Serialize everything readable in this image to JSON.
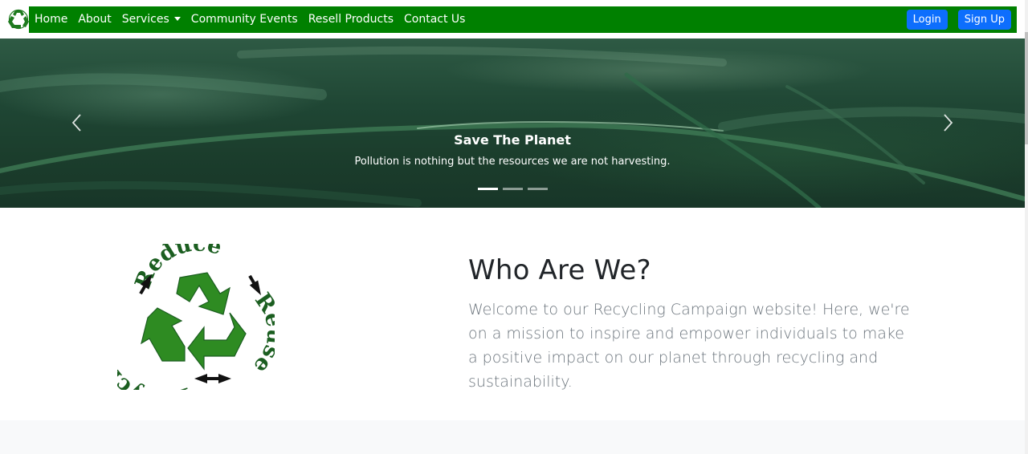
{
  "nav": {
    "logo_icon": "recycle-icon",
    "links": [
      "Home",
      "About",
      "Services",
      "Community Events",
      "Resell Products",
      "Contact Us"
    ],
    "login_label": "Login",
    "signup_label": "Sign Up",
    "bar_color": "#008000",
    "button_color": "#0d6efd"
  },
  "hero": {
    "title": "Save The Planet",
    "text": "Pollution is nothing but the resources we are not harvesting.",
    "slides": 3,
    "active_slide": 1,
    "prev_icon": "chevron-left-icon",
    "next_icon": "chevron-right-icon"
  },
  "about": {
    "title": "Who Are We?",
    "text": "Welcome to our Recycling Campaign website! Here, we're on a mission to inspire and empower individuals to make a positive impact on our planet through recycling and sustainability.",
    "logo_words": [
      "Reduce",
      "Reuse",
      "Recycle"
    ]
  }
}
